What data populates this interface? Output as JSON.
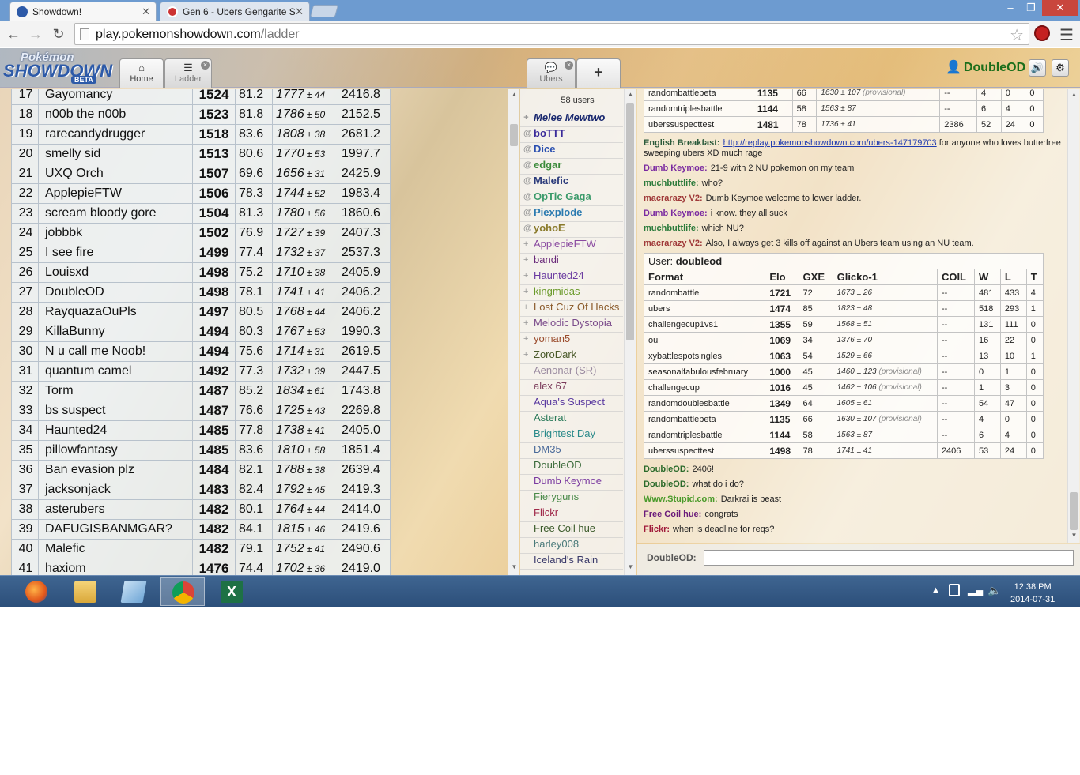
{
  "browser": {
    "tabs": [
      {
        "title": "Showdown!",
        "active": true
      },
      {
        "title": "Gen 6 - Ubers Gengarite S",
        "active": false
      }
    ],
    "url_host": "play.pokemonshowdown.com",
    "url_path": "/ladder",
    "window_controls": {
      "minimize": "–",
      "maximize": "❐",
      "close": "✕"
    }
  },
  "header": {
    "logo_top": "Pokémon",
    "logo_main": "SHOWDOWN",
    "logo_badge": "BETA",
    "tabs": [
      {
        "label": "Home",
        "icon": "home-icon"
      },
      {
        "label": "Ladder",
        "icon": "list-icon"
      },
      {
        "label": "Ubers",
        "icon": "chat-bubble-icon"
      }
    ],
    "plus": "+",
    "username": "DoubleOD",
    "sound_icon": "🔊",
    "settings_icon": "⚙"
  },
  "ladder": {
    "rows": [
      {
        "rank": "17",
        "name": "Gayomancy",
        "elo": "1524",
        "gxe": "81.2",
        "glicko": "1777",
        "dev": "44",
        "coil": "2416.8"
      },
      {
        "rank": "18",
        "name": "n00b the n00b",
        "elo": "1523",
        "gxe": "81.8",
        "glicko": "1786",
        "dev": "50",
        "coil": "2152.5"
      },
      {
        "rank": "19",
        "name": "rarecandydrugger",
        "elo": "1518",
        "gxe": "83.6",
        "glicko": "1808",
        "dev": "38",
        "coil": "2681.2"
      },
      {
        "rank": "20",
        "name": "smelly sid",
        "elo": "1513",
        "gxe": "80.6",
        "glicko": "1770",
        "dev": "53",
        "coil": "1997.7"
      },
      {
        "rank": "21",
        "name": "UXQ Orch",
        "elo": "1507",
        "gxe": "69.6",
        "glicko": "1656",
        "dev": "31",
        "coil": "2425.9"
      },
      {
        "rank": "22",
        "name": "ApplepieFTW",
        "elo": "1506",
        "gxe": "78.3",
        "glicko": "1744",
        "dev": "52",
        "coil": "1983.4"
      },
      {
        "rank": "23",
        "name": "scream bloody gore",
        "elo": "1504",
        "gxe": "81.3",
        "glicko": "1780",
        "dev": "56",
        "coil": "1860.6"
      },
      {
        "rank": "24",
        "name": "jobbbk",
        "elo": "1502",
        "gxe": "76.9",
        "glicko": "1727",
        "dev": "39",
        "coil": "2407.3"
      },
      {
        "rank": "25",
        "name": "I see fire",
        "elo": "1499",
        "gxe": "77.4",
        "glicko": "1732",
        "dev": "37",
        "coil": "2537.3"
      },
      {
        "rank": "26",
        "name": "Louisxd",
        "elo": "1498",
        "gxe": "75.2",
        "glicko": "1710",
        "dev": "38",
        "coil": "2405.9"
      },
      {
        "rank": "27",
        "name": "DoubleOD",
        "elo": "1498",
        "gxe": "78.1",
        "glicko": "1741",
        "dev": "41",
        "coil": "2406.2"
      },
      {
        "rank": "28",
        "name": "RayquazaOuPls",
        "elo": "1497",
        "gxe": "80.5",
        "glicko": "1768",
        "dev": "44",
        "coil": "2406.2"
      },
      {
        "rank": "29",
        "name": "KillaBunny",
        "elo": "1494",
        "gxe": "80.3",
        "glicko": "1767",
        "dev": "53",
        "coil": "1990.3"
      },
      {
        "rank": "30",
        "name": "N u call me Noob!",
        "elo": "1494",
        "gxe": "75.6",
        "glicko": "1714",
        "dev": "31",
        "coil": "2619.5"
      },
      {
        "rank": "31",
        "name": "quantum camel",
        "elo": "1492",
        "gxe": "77.3",
        "glicko": "1732",
        "dev": "39",
        "coil": "2447.5"
      },
      {
        "rank": "32",
        "name": "Torm",
        "elo": "1487",
        "gxe": "85.2",
        "glicko": "1834",
        "dev": "61",
        "coil": "1743.8"
      },
      {
        "rank": "33",
        "name": "bs suspect",
        "elo": "1487",
        "gxe": "76.6",
        "glicko": "1725",
        "dev": "43",
        "coil": "2269.8"
      },
      {
        "rank": "34",
        "name": "Haunted24",
        "elo": "1485",
        "gxe": "77.8",
        "glicko": "1738",
        "dev": "41",
        "coil": "2405.0"
      },
      {
        "rank": "35",
        "name": "pillowfantasy",
        "elo": "1485",
        "gxe": "83.6",
        "glicko": "1810",
        "dev": "58",
        "coil": "1851.4"
      },
      {
        "rank": "36",
        "name": "Ban evasion plz",
        "elo": "1484",
        "gxe": "82.1",
        "glicko": "1788",
        "dev": "38",
        "coil": "2639.4"
      },
      {
        "rank": "37",
        "name": "jacksonjack",
        "elo": "1483",
        "gxe": "82.4",
        "glicko": "1792",
        "dev": "45",
        "coil": "2419.3"
      },
      {
        "rank": "38",
        "name": "asterubers",
        "elo": "1482",
        "gxe": "80.1",
        "glicko": "1764",
        "dev": "44",
        "coil": "2414.0"
      },
      {
        "rank": "39",
        "name": "DAFUGISBANMGAR?",
        "elo": "1482",
        "gxe": "84.1",
        "glicko": "1815",
        "dev": "46",
        "coil": "2419.6"
      },
      {
        "rank": "40",
        "name": "Malefic",
        "elo": "1482",
        "gxe": "79.1",
        "glicko": "1752",
        "dev": "41",
        "coil": "2490.6"
      },
      {
        "rank": "41",
        "name": "haxiom",
        "elo": "1476",
        "gxe": "74.4",
        "glicko": "1702",
        "dev": "36",
        "coil": "2419.0"
      }
    ]
  },
  "userlist": {
    "count": "58 users",
    "users": [
      {
        "group": "+",
        "name": "Melee Mewtwo",
        "color": "#1b2a70",
        "bold": true,
        "italic": true
      },
      {
        "group": "@",
        "name": "boTTT",
        "color": "#3a2a9a",
        "bold": true,
        "italic": false
      },
      {
        "group": "@",
        "name": "Dice",
        "color": "#2a4fb0",
        "bold": true,
        "italic": false
      },
      {
        "group": "@",
        "name": "edgar",
        "color": "#3a8a3a",
        "bold": true,
        "italic": false
      },
      {
        "group": "@",
        "name": "Malefic",
        "color": "#2a3a7a",
        "bold": true,
        "italic": false
      },
      {
        "group": "@",
        "name": "OpTic Gaga",
        "color": "#3a9a6a",
        "bold": true,
        "italic": false
      },
      {
        "group": "@",
        "name": "Piexplode",
        "color": "#2a7ab0",
        "bold": true,
        "italic": false
      },
      {
        "group": "@",
        "name": "yohoE",
        "color": "#8a7a2a",
        "bold": true,
        "italic": false
      },
      {
        "group": "+",
        "name": "ApplepieFTW",
        "color": "#8a4aa0",
        "bold": false,
        "italic": false
      },
      {
        "group": "+",
        "name": "bandi",
        "color": "#6a2a7a",
        "bold": false,
        "italic": false
      },
      {
        "group": "+",
        "name": "Haunted24",
        "color": "#6a3aa0",
        "bold": false,
        "italic": false
      },
      {
        "group": "+",
        "name": "kingmidas",
        "color": "#6a9a2a",
        "bold": false,
        "italic": false
      },
      {
        "group": "+",
        "name": "Lost Cuz Of Hacks",
        "color": "#8a5a2a",
        "bold": false,
        "italic": false
      },
      {
        "group": "+",
        "name": "Melodic Dystopia",
        "color": "#7a4a8a",
        "bold": false,
        "italic": false
      },
      {
        "group": "+",
        "name": "yoman5",
        "color": "#9a4a2a",
        "bold": false,
        "italic": false
      },
      {
        "group": "+",
        "name": "ZoroDark",
        "color": "#4a5a2a",
        "bold": false,
        "italic": false
      },
      {
        "group": " ",
        "name": "Aenonar (SR)",
        "color": "#9a8aa0",
        "bold": false,
        "italic": false
      },
      {
        "group": " ",
        "name": "alex 67",
        "color": "#7a3a5a",
        "bold": false,
        "italic": false
      },
      {
        "group": " ",
        "name": "Aqua's Suspect",
        "color": "#5a3aa0",
        "bold": false,
        "italic": false
      },
      {
        "group": " ",
        "name": "Asterat",
        "color": "#2a7a5a",
        "bold": false,
        "italic": false
      },
      {
        "group": " ",
        "name": "Brightest Day",
        "color": "#2a8a8a",
        "bold": false,
        "italic": false
      },
      {
        "group": " ",
        "name": "DM35",
        "color": "#4a6a9a",
        "bold": false,
        "italic": false
      },
      {
        "group": " ",
        "name": "DoubleOD",
        "color": "#3a6a3a",
        "bold": false,
        "italic": false
      },
      {
        "group": " ",
        "name": "Dumb Keymoe",
        "color": "#7a3aa0",
        "bold": false,
        "italic": false
      },
      {
        "group": " ",
        "name": "Fieryguns",
        "color": "#4a8a4a",
        "bold": false,
        "italic": false
      },
      {
        "group": " ",
        "name": "Flickr",
        "color": "#a02a4a",
        "bold": false,
        "italic": false
      },
      {
        "group": " ",
        "name": "Free Coil hue",
        "color": "#3a5a2a",
        "bold": false,
        "italic": false
      },
      {
        "group": " ",
        "name": "harley008",
        "color": "#4a7a7a",
        "bold": false,
        "italic": false
      },
      {
        "group": " ",
        "name": "Iceland's Rain",
        "color": "#3a3a6a",
        "bold": false,
        "italic": false
      }
    ]
  },
  "chat": {
    "table1": [
      {
        "format": "randombattlebeta",
        "elo": "1135",
        "gxe": "66",
        "glicko": "1630",
        "dev": "107",
        "prov": "(provisional)",
        "coil": "--",
        "w": "4",
        "l": "0",
        "t": "0"
      },
      {
        "format": "randomtriplesbattle",
        "elo": "1144",
        "gxe": "58",
        "glicko": "1563",
        "dev": "87",
        "prov": "",
        "coil": "--",
        "w": "6",
        "l": "4",
        "t": "0"
      },
      {
        "format": "uberssuspecttest",
        "elo": "1481",
        "gxe": "78",
        "glicko": "1736",
        "dev": "41",
        "prov": "",
        "coil": "2386",
        "w": "52",
        "l": "24",
        "t": "0"
      }
    ],
    "messages1": [
      {
        "who": "English Breakfast:",
        "color": "#2a5a3a",
        "text": "",
        "link": "http://replay.pokemonshowdown.com/ubers-147179703",
        "after": " for anyone who loves butterfree sweeping ubers XD much rage"
      },
      {
        "who": "Dumb Keymoe:",
        "color": "#7a2aa0",
        "text": "21-9 with 2 NU pokemon on my team",
        "link": "",
        "after": ""
      },
      {
        "who": "muchbuttlife:",
        "color": "#2a7a3a",
        "text": "who?",
        "link": "",
        "after": ""
      },
      {
        "who": "macrarazy V2:",
        "color": "#a03a3a",
        "text": "Dumb Keymoe welcome to lower ladder.",
        "link": "",
        "after": ""
      },
      {
        "who": "Dumb Keymoe:",
        "color": "#7a2aa0",
        "text": "i know. they all suck",
        "link": "",
        "after": ""
      },
      {
        "who": "muchbuttlife:",
        "color": "#2a7a3a",
        "text": "which NU?",
        "link": "",
        "after": ""
      },
      {
        "who": "macrarazy V2:",
        "color": "#a03a3a",
        "text": "Also, I always get 3 kills off against an Ubers team using an NU team.",
        "link": "",
        "after": ""
      }
    ],
    "table2_user_label": "User:",
    "table2_user": "doubleod",
    "table2_headers": [
      "Format",
      "Elo",
      "GXE",
      "Glicko-1",
      "COIL",
      "W",
      "L",
      "T"
    ],
    "table2": [
      {
        "format": "randombattle",
        "elo": "1721",
        "gxe": "72",
        "glicko": "1673",
        "dev": "26",
        "prov": "",
        "coil": "--",
        "w": "481",
        "l": "433",
        "t": "4"
      },
      {
        "format": "ubers",
        "elo": "1474",
        "gxe": "85",
        "glicko": "1823",
        "dev": "48",
        "prov": "",
        "coil": "--",
        "w": "518",
        "l": "293",
        "t": "1"
      },
      {
        "format": "challengecup1vs1",
        "elo": "1355",
        "gxe": "59",
        "glicko": "1568",
        "dev": "51",
        "prov": "",
        "coil": "--",
        "w": "131",
        "l": "111",
        "t": "0"
      },
      {
        "format": "ou",
        "elo": "1069",
        "gxe": "34",
        "glicko": "1376",
        "dev": "70",
        "prov": "",
        "coil": "--",
        "w": "16",
        "l": "22",
        "t": "0"
      },
      {
        "format": "xybattlespotsingles",
        "elo": "1063",
        "gxe": "54",
        "glicko": "1529",
        "dev": "66",
        "prov": "",
        "coil": "--",
        "w": "13",
        "l": "10",
        "t": "1"
      },
      {
        "format": "seasonalfabulousfebruary",
        "elo": "1000",
        "gxe": "45",
        "glicko": "1460",
        "dev": "123",
        "prov": "(provisional)",
        "coil": "--",
        "w": "0",
        "l": "1",
        "t": "0"
      },
      {
        "format": "challengecup",
        "elo": "1016",
        "gxe": "45",
        "glicko": "1462",
        "dev": "106",
        "prov": "(provisional)",
        "coil": "--",
        "w": "1",
        "l": "3",
        "t": "0"
      },
      {
        "format": "randomdoublesbattle",
        "elo": "1349",
        "gxe": "64",
        "glicko": "1605",
        "dev": "61",
        "prov": "",
        "coil": "--",
        "w": "54",
        "l": "47",
        "t": "0"
      },
      {
        "format": "randombattlebeta",
        "elo": "1135",
        "gxe": "66",
        "glicko": "1630",
        "dev": "107",
        "prov": "(provisional)",
        "coil": "--",
        "w": "4",
        "l": "0",
        "t": "0"
      },
      {
        "format": "randomtriplesbattle",
        "elo": "1144",
        "gxe": "58",
        "glicko": "1563",
        "dev": "87",
        "prov": "",
        "coil": "--",
        "w": "6",
        "l": "4",
        "t": "0"
      },
      {
        "format": "uberssuspecttest",
        "elo": "1498",
        "gxe": "78",
        "glicko": "1741",
        "dev": "41",
        "prov": "",
        "coil": "2406",
        "w": "53",
        "l": "24",
        "t": "0"
      }
    ],
    "messages2": [
      {
        "who": "DoubleOD:",
        "color": "#2a6a2a",
        "text": "2406!",
        "link": "",
        "after": ""
      },
      {
        "who": "DoubleOD:",
        "color": "#2a6a2a",
        "text": "what do i do?",
        "link": "",
        "after": ""
      },
      {
        "who": "Www.Stupid.com:",
        "color": "#4a9a2a",
        "text": "Darkrai is beast",
        "link": "",
        "after": ""
      },
      {
        "who": "Free Coil hue:",
        "color": "#6a1a7a",
        "text": "congrats",
        "link": "",
        "after": ""
      },
      {
        "who": "Flickr:",
        "color": "#a01a3a",
        "text": "when is deadline for reqs?",
        "link": "",
        "after": ""
      }
    ],
    "input_label": "DoubleOD:"
  },
  "taskbar": {
    "apps": [
      "firefox-icon",
      "file-explorer-icon",
      "notepad-icon",
      "chrome-icon",
      "excel-icon"
    ],
    "time": "12:38 PM",
    "date": "2014-07-31"
  },
  "colors": {
    "title_bar": "#6d9bd0",
    "taskbar": "#2c4f7a",
    "username": "#1b6e1b"
  }
}
